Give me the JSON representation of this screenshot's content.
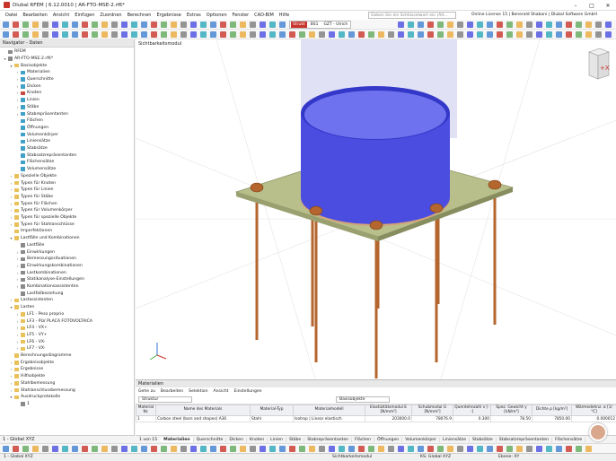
{
  "titlebar": {
    "title": "Dlubal RFEM | 6.12.0010 | AR-FTO-MSE-2.rf6*",
    "minimize": "–",
    "maximize": "□",
    "close": "✕"
  },
  "menu": {
    "items": [
      "Datei",
      "Bearbeiten",
      "Ansicht",
      "Einfügen",
      "Zuordnen",
      "Berechnen",
      "Ergebnisse",
      "Extras",
      "Optionen",
      "Fenster",
      "CAD-BIM",
      "Hilfe"
    ],
    "search_placeholder": "Geben Sie ein Schlüsselwort ein (Alt...",
    "license": "Online License 15 | Benerald Shabani | Dlubal Software GmbH"
  },
  "loadcase": {
    "tag": "Strukt",
    "name": "BS1",
    "desc": "GZT - Ulrich"
  },
  "navigator": {
    "title": "Navigator - Daten",
    "root": "RFEM",
    "model": "AR-FTO-MSE-2.rf6*",
    "footer": "1 - Global XYZ"
  },
  "tree": [
    {
      "label": "RFEM",
      "lvl": 0,
      "ex": "",
      "ic": "gry"
    },
    {
      "label": "AR-FTO-MSE-2.rf6*",
      "lvl": 0,
      "ex": "▾",
      "ic": "gry"
    },
    {
      "label": "Basisobjekte",
      "lvl": 1,
      "ex": "▾",
      "ic": "folder"
    },
    {
      "label": "Materialien",
      "lvl": 2,
      "ex": "›",
      "ic": "cyan"
    },
    {
      "label": "Querschnitte",
      "lvl": 2,
      "ex": "›",
      "ic": "cyan"
    },
    {
      "label": "Dicken",
      "lvl": 2,
      "ex": "›",
      "ic": "cyan"
    },
    {
      "label": "Knoten",
      "lvl": 2,
      "ex": "›",
      "ic": "red"
    },
    {
      "label": "Linien",
      "lvl": 2,
      "ex": "›",
      "ic": "cyan"
    },
    {
      "label": "Stäbe",
      "lvl": 2,
      "ex": "›",
      "ic": "cyan"
    },
    {
      "label": "Stabrepräsentanten",
      "lvl": 2,
      "ex": "›",
      "ic": "cyan"
    },
    {
      "label": "Flächen",
      "lvl": 2,
      "ex": "",
      "ic": "cyan"
    },
    {
      "label": "Öffnungen",
      "lvl": 2,
      "ex": "",
      "ic": "cyan"
    },
    {
      "label": "Volumenkörper",
      "lvl": 2,
      "ex": "",
      "ic": "cyan"
    },
    {
      "label": "Liniensätze",
      "lvl": 2,
      "ex": "",
      "ic": "cyan"
    },
    {
      "label": "Stabsätze",
      "lvl": 2,
      "ex": "",
      "ic": "cyan"
    },
    {
      "label": "Stabsatzrepräsentanten",
      "lvl": 2,
      "ex": "",
      "ic": "cyan"
    },
    {
      "label": "Flächensätze",
      "lvl": 2,
      "ex": "",
      "ic": "cyan"
    },
    {
      "label": "Volumensätze",
      "lvl": 2,
      "ex": "",
      "ic": "cyan"
    },
    {
      "label": "Spezielle Objekte",
      "lvl": 1,
      "ex": "›",
      "ic": "folder"
    },
    {
      "label": "Typen für Knoten",
      "lvl": 1,
      "ex": "›",
      "ic": "folder"
    },
    {
      "label": "Typen für Linien",
      "lvl": 1,
      "ex": "›",
      "ic": "folder"
    },
    {
      "label": "Typen für Stäbe",
      "lvl": 1,
      "ex": "›",
      "ic": "folder"
    },
    {
      "label": "Typen für Flächen",
      "lvl": 1,
      "ex": "›",
      "ic": "folder"
    },
    {
      "label": "Typen für Volumenkörper",
      "lvl": 1,
      "ex": "›",
      "ic": "folder"
    },
    {
      "label": "Typen für spezielle Objekte",
      "lvl": 1,
      "ex": "›",
      "ic": "folder"
    },
    {
      "label": "Typen für Stahlanschlüsse",
      "lvl": 1,
      "ex": "›",
      "ic": "folder"
    },
    {
      "label": "Imperfektionen",
      "lvl": 1,
      "ex": "",
      "ic": "folder"
    },
    {
      "label": "Lastfälle und Kombinationen",
      "lvl": 1,
      "ex": "▾",
      "ic": "folder"
    },
    {
      "label": "Lastfälle",
      "lvl": 2,
      "ex": "",
      "ic": "gry"
    },
    {
      "label": "Einwirkungen",
      "lvl": 2,
      "ex": "›",
      "ic": "gry"
    },
    {
      "label": "Bemessungssituationen",
      "lvl": 2,
      "ex": "›",
      "ic": "gry"
    },
    {
      "label": "Einwirkungskombinationen",
      "lvl": 2,
      "ex": "›",
      "ic": "gry"
    },
    {
      "label": "Lastkombinationen",
      "lvl": 2,
      "ex": "›",
      "ic": "gry"
    },
    {
      "label": "Statikanalyse-Einstellungen",
      "lvl": 2,
      "ex": "›",
      "ic": "gry"
    },
    {
      "label": "Kombinationsassistenten",
      "lvl": 2,
      "ex": "›",
      "ic": "gry"
    },
    {
      "label": "Lastfallbeziehung",
      "lvl": 2,
      "ex": "",
      "ic": "gry"
    },
    {
      "label": "Lastassistenten",
      "lvl": 1,
      "ex": "›",
      "ic": "folder"
    },
    {
      "label": "Lasten",
      "lvl": 1,
      "ex": "▾",
      "ic": "folder"
    },
    {
      "label": "LF1 - Peso proprio",
      "lvl": 2,
      "ex": "›",
      "ic": "folder"
    },
    {
      "label": "LF3 - PLV PLACA FOTOVOLTAICA",
      "lvl": 2,
      "ex": "›",
      "ic": "folder"
    },
    {
      "label": "LF4 - VX+",
      "lvl": 2,
      "ex": "›",
      "ic": "folder"
    },
    {
      "label": "LF5 - VY+",
      "lvl": 2,
      "ex": "›",
      "ic": "folder"
    },
    {
      "label": "LF6 - VX-",
      "lvl": 2,
      "ex": "›",
      "ic": "folder"
    },
    {
      "label": "LF7 - VX-",
      "lvl": 2,
      "ex": "›",
      "ic": "folder"
    },
    {
      "label": "Berechnungsdiagramme",
      "lvl": 1,
      "ex": "",
      "ic": "folder"
    },
    {
      "label": "Ergebnisobjekte",
      "lvl": 1,
      "ex": "›",
      "ic": "folder"
    },
    {
      "label": "Ergebnisse",
      "lvl": 1,
      "ex": "›",
      "ic": "folder"
    },
    {
      "label": "Hilfsobjekte",
      "lvl": 1,
      "ex": "›",
      "ic": "folder"
    },
    {
      "label": "Stahlbemessung",
      "lvl": 1,
      "ex": "›",
      "ic": "folder"
    },
    {
      "label": "Stahlanschlussbemessung",
      "lvl": 1,
      "ex": "›",
      "ic": "folder"
    },
    {
      "label": "Ausdruckprotokolle",
      "lvl": 1,
      "ex": "▾",
      "ic": "folder"
    },
    {
      "label": "1",
      "lvl": 2,
      "ex": "",
      "ic": "gry"
    }
  ],
  "view": {
    "title": "Sichtbarkeitsmodul"
  },
  "materials_panel": {
    "title": "Materialien",
    "menu": [
      "Gehe zu",
      "Bearbeiten",
      "Selektion",
      "Ansicht",
      "Einstellungen"
    ],
    "filter1": "Struktur",
    "filter2": "Basisobjekte",
    "columns": [
      "Material Nr.",
      "Name des Materials",
      "Material-Typ",
      "Materialmodell",
      "Elastizitätsmodul E [N/mm²]",
      "Schubmodul G [N/mm²]",
      "Querdehnzahl ν [--]",
      "Spez. Gewicht γ [kN/m³]",
      "Dichte ρ [kg/m³]",
      "Wärmedehnz. α [1/°C]"
    ],
    "rows": [
      [
        "1",
        "Carbon steel (bars and shapes) A36",
        "Stahl",
        "Isotrop | Linear elastisch",
        "203000.0",
        "78076.9",
        "0.300",
        "78.50",
        "7850.00",
        "0.000012"
      ]
    ],
    "pager": "1 von 15",
    "tabs": [
      "Materialien",
      "Querschnitte",
      "Dicken",
      "Knoten",
      "Linien",
      "Stäbe",
      "Stabrepräsentanten",
      "Flächen",
      "Öffnungen",
      "Volumenkörper",
      "Liniensätze",
      "Stabsätze",
      "Stabsatzrepräsentanten",
      "Flächensätze"
    ]
  },
  "status": {
    "left": "1 - Global XYZ",
    "mid": "Sichtbarkeitsmodul",
    "ks": "KS: Global XYZ",
    "ebene": "Ebene: XY"
  },
  "colors": {
    "accent": "#c8352b",
    "cylinder": "#4a4de0",
    "plate": "#b8bf8a",
    "rod": "#b5652e"
  }
}
